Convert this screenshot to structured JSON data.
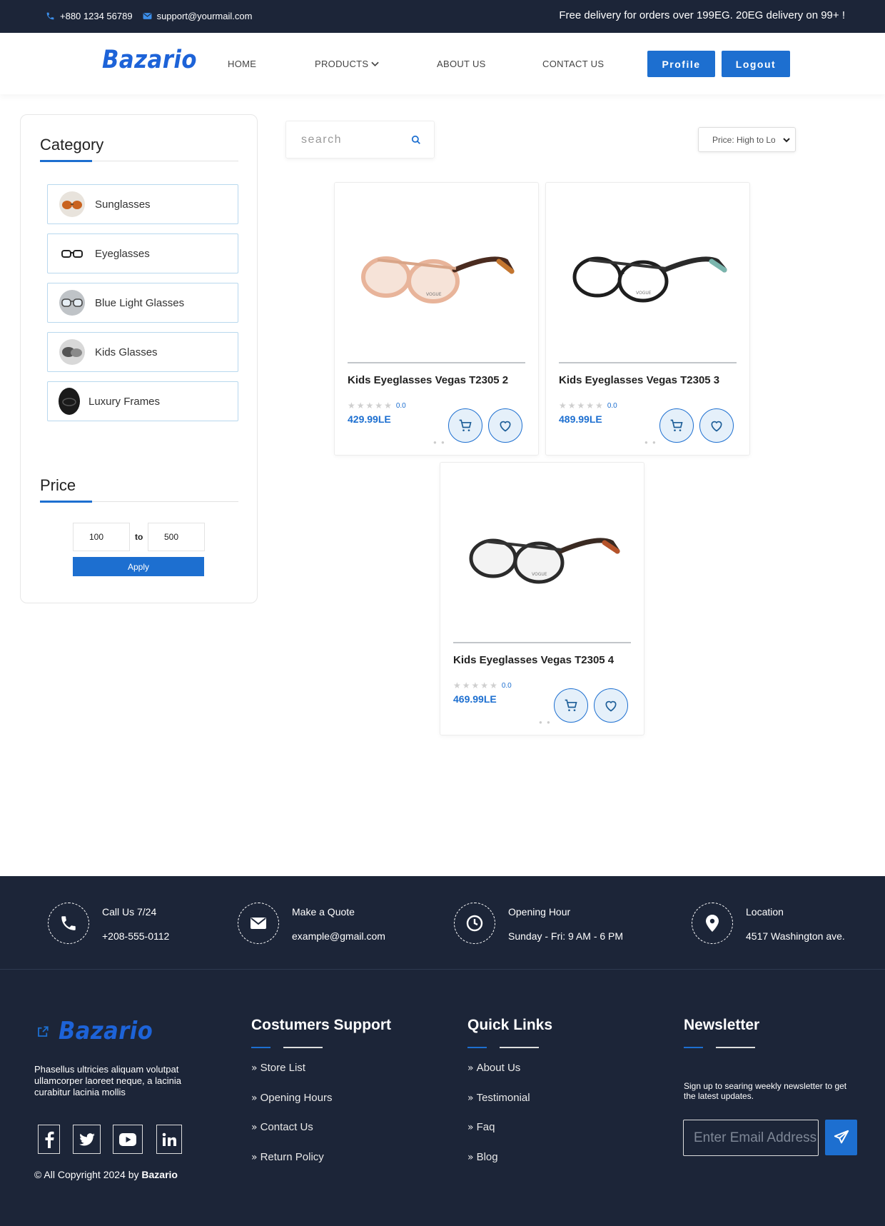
{
  "topbar": {
    "phone": "+880 1234 56789",
    "email": "support@yourmail.com",
    "promo": "Free delivery for orders over 199EG. 20EG delivery on 99+ !"
  },
  "header": {
    "logo": "Bazario",
    "nav": [
      "HOME",
      "PRODUCTS",
      "ABOUT US",
      "CONTACT US"
    ],
    "profile_label": "Profile",
    "logout_label": "Logout"
  },
  "sidebar": {
    "category_title": "Category",
    "categories": [
      "Sunglasses",
      "Eyeglasses",
      "Blue Light Glasses",
      "Kids Glasses",
      "Luxury Frames"
    ],
    "price_title": "Price",
    "price_min": "100",
    "price_to": "to",
    "price_max": "500",
    "apply_label": "Apply"
  },
  "toolbar": {
    "search_placeholder": "search",
    "sort_selected": "Price: High to Low"
  },
  "products": [
    {
      "name": "Kids Eyeglasses Vegas T2305 2",
      "rating": "0.0",
      "price": "429.99LE",
      "frame_color": "#e8b49a",
      "temple_color": "#4a2b1f",
      "tip_color": "#c4762f"
    },
    {
      "name": "Kids Eyeglasses Vegas T2305 3",
      "rating": "0.0",
      "price": "489.99LE",
      "frame_color": "#1e1e1e",
      "temple_color": "#2a2a2a",
      "tip_color": "#7ab5ad"
    },
    {
      "name": "Kids Eyeglasses Vegas T2305 4",
      "rating": "0.0",
      "price": "469.99LE",
      "frame_color": "#2b2b2b",
      "temple_color": "#3a2a22",
      "tip_color": "#b5532a"
    }
  ],
  "footer": {
    "info": [
      {
        "title": "Call Us 7/24",
        "value": "+208-555-0112",
        "icon": "phone-icon"
      },
      {
        "title": "Make a Quote",
        "value": "example@gmail.com",
        "icon": "envelope-icon"
      },
      {
        "title": "Opening Hour",
        "value": "Sunday - Fri: 9 AM - 6 PM",
        "icon": "clock-icon"
      },
      {
        "title": "Location",
        "value": "4517 Washington ave.",
        "icon": "location-pin-icon"
      }
    ],
    "logo": "Bazario",
    "about": "Phasellus ultricies aliquam volutpat ullamcorper laoreet neque, a lacinia curabitur lacinia mollis",
    "copyright_prefix": "© All Copyright 2024 by",
    "copyright_brand": "Bazario",
    "support_title": "Costumers Support",
    "support_links": [
      "Store List",
      "Opening Hours",
      "Contact Us",
      "Return Policy"
    ],
    "quick_title": "Quick Links",
    "quick_links": [
      "About Us",
      "Testimonial",
      "Faq",
      "Blog"
    ],
    "newsletter_title": "Newsletter",
    "newsletter_text": "Sign up to searing weekly newsletter to get the latest updates.",
    "email_placeholder": "Enter Email Address"
  },
  "colors": {
    "accent": "#1d6fd0",
    "dark": "#1c2538"
  }
}
